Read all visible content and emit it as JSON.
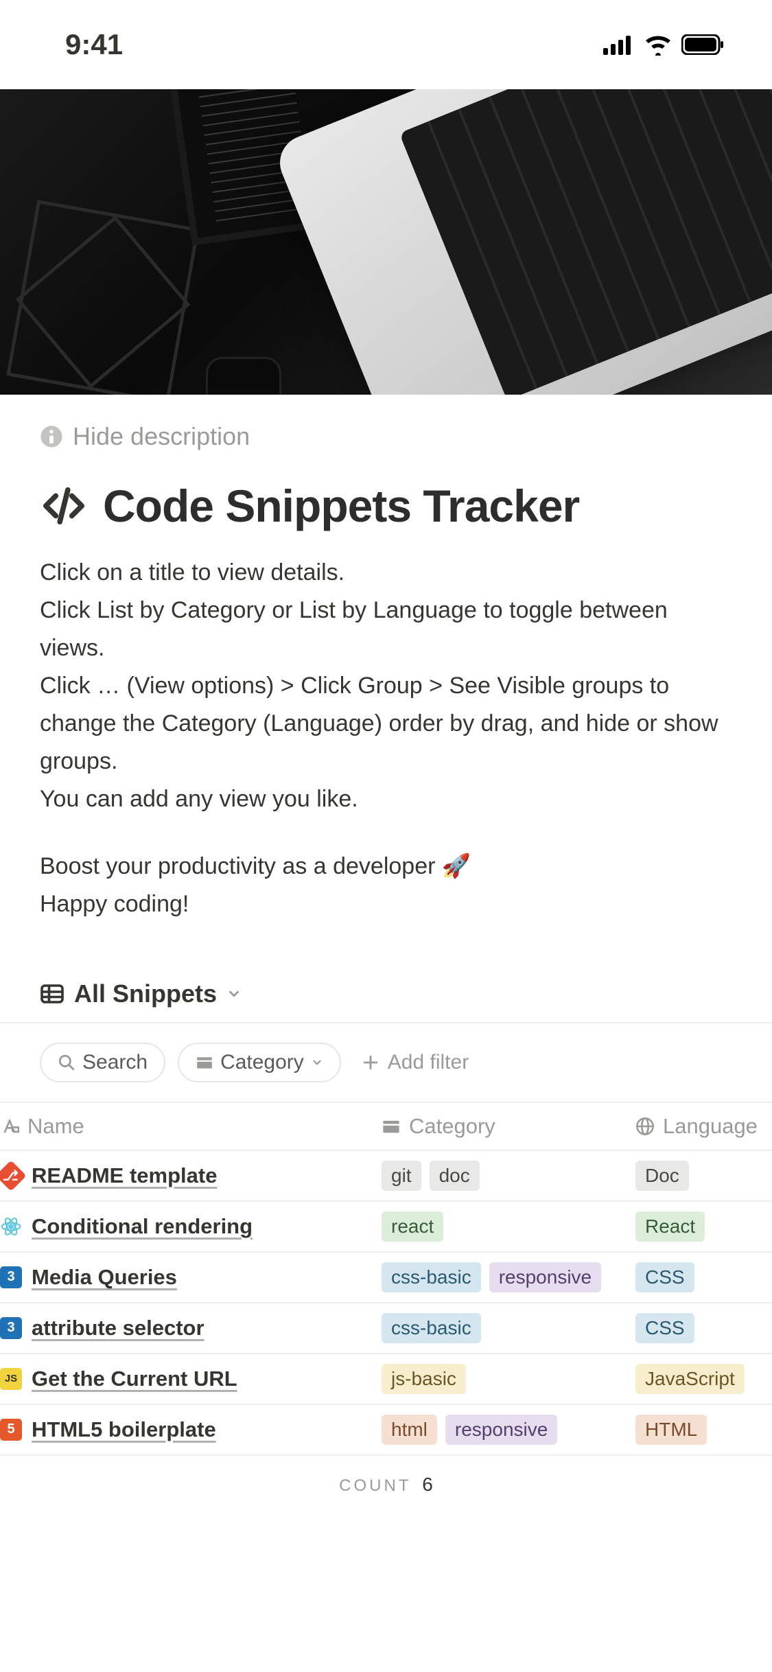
{
  "status": {
    "time": "9:41"
  },
  "header": {
    "hide_desc": "Hide description",
    "title": "Code Snippets Tracker"
  },
  "description": {
    "line1": "Click on a title to view details.",
    "line2": "Click List by Category or List by Language to toggle between views.",
    "line3": "Click … (View options)  > Click Group > See Visible groups to change the Category (Language) order by drag, and hide or show groups.",
    "line4": "You can add any view you like.",
    "line5": "Boost your productivity as a developer 🚀",
    "line6": "Happy coding!"
  },
  "view": {
    "name": "All Snippets"
  },
  "filter_bar": {
    "search": "Search",
    "category": "Category",
    "add_filter": "Add filter"
  },
  "columns": {
    "name": "Name",
    "category": "Category",
    "language": "Language"
  },
  "rows": [
    {
      "icon": "git",
      "title": "README template",
      "categories": [
        {
          "label": "git",
          "tone": "gray"
        },
        {
          "label": "doc",
          "tone": "gray"
        }
      ],
      "language": {
        "label": "Doc",
        "tone": "gray"
      }
    },
    {
      "icon": "react",
      "title": "Conditional rendering",
      "categories": [
        {
          "label": "react",
          "tone": "green"
        }
      ],
      "language": {
        "label": "React",
        "tone": "green"
      }
    },
    {
      "icon": "css",
      "title": "Media Queries",
      "categories": [
        {
          "label": "css-basic",
          "tone": "blue"
        },
        {
          "label": "responsive",
          "tone": "purple"
        }
      ],
      "language": {
        "label": "CSS",
        "tone": "blue"
      }
    },
    {
      "icon": "css",
      "title": "attribute selector",
      "categories": [
        {
          "label": "css-basic",
          "tone": "blue"
        }
      ],
      "language": {
        "label": "CSS",
        "tone": "blue"
      }
    },
    {
      "icon": "js",
      "title": "Get the Current URL",
      "categories": [
        {
          "label": "js-basic",
          "tone": "yellow"
        }
      ],
      "language": {
        "label": "JavaScript",
        "tone": "yellow"
      }
    },
    {
      "icon": "html",
      "title": "HTML5 boilerplate",
      "categories": [
        {
          "label": "html",
          "tone": "orange"
        },
        {
          "label": "responsive",
          "tone": "purple"
        }
      ],
      "language": {
        "label": "HTML",
        "tone": "orange"
      }
    }
  ],
  "count": {
    "label": "COUNT",
    "value": "6"
  }
}
